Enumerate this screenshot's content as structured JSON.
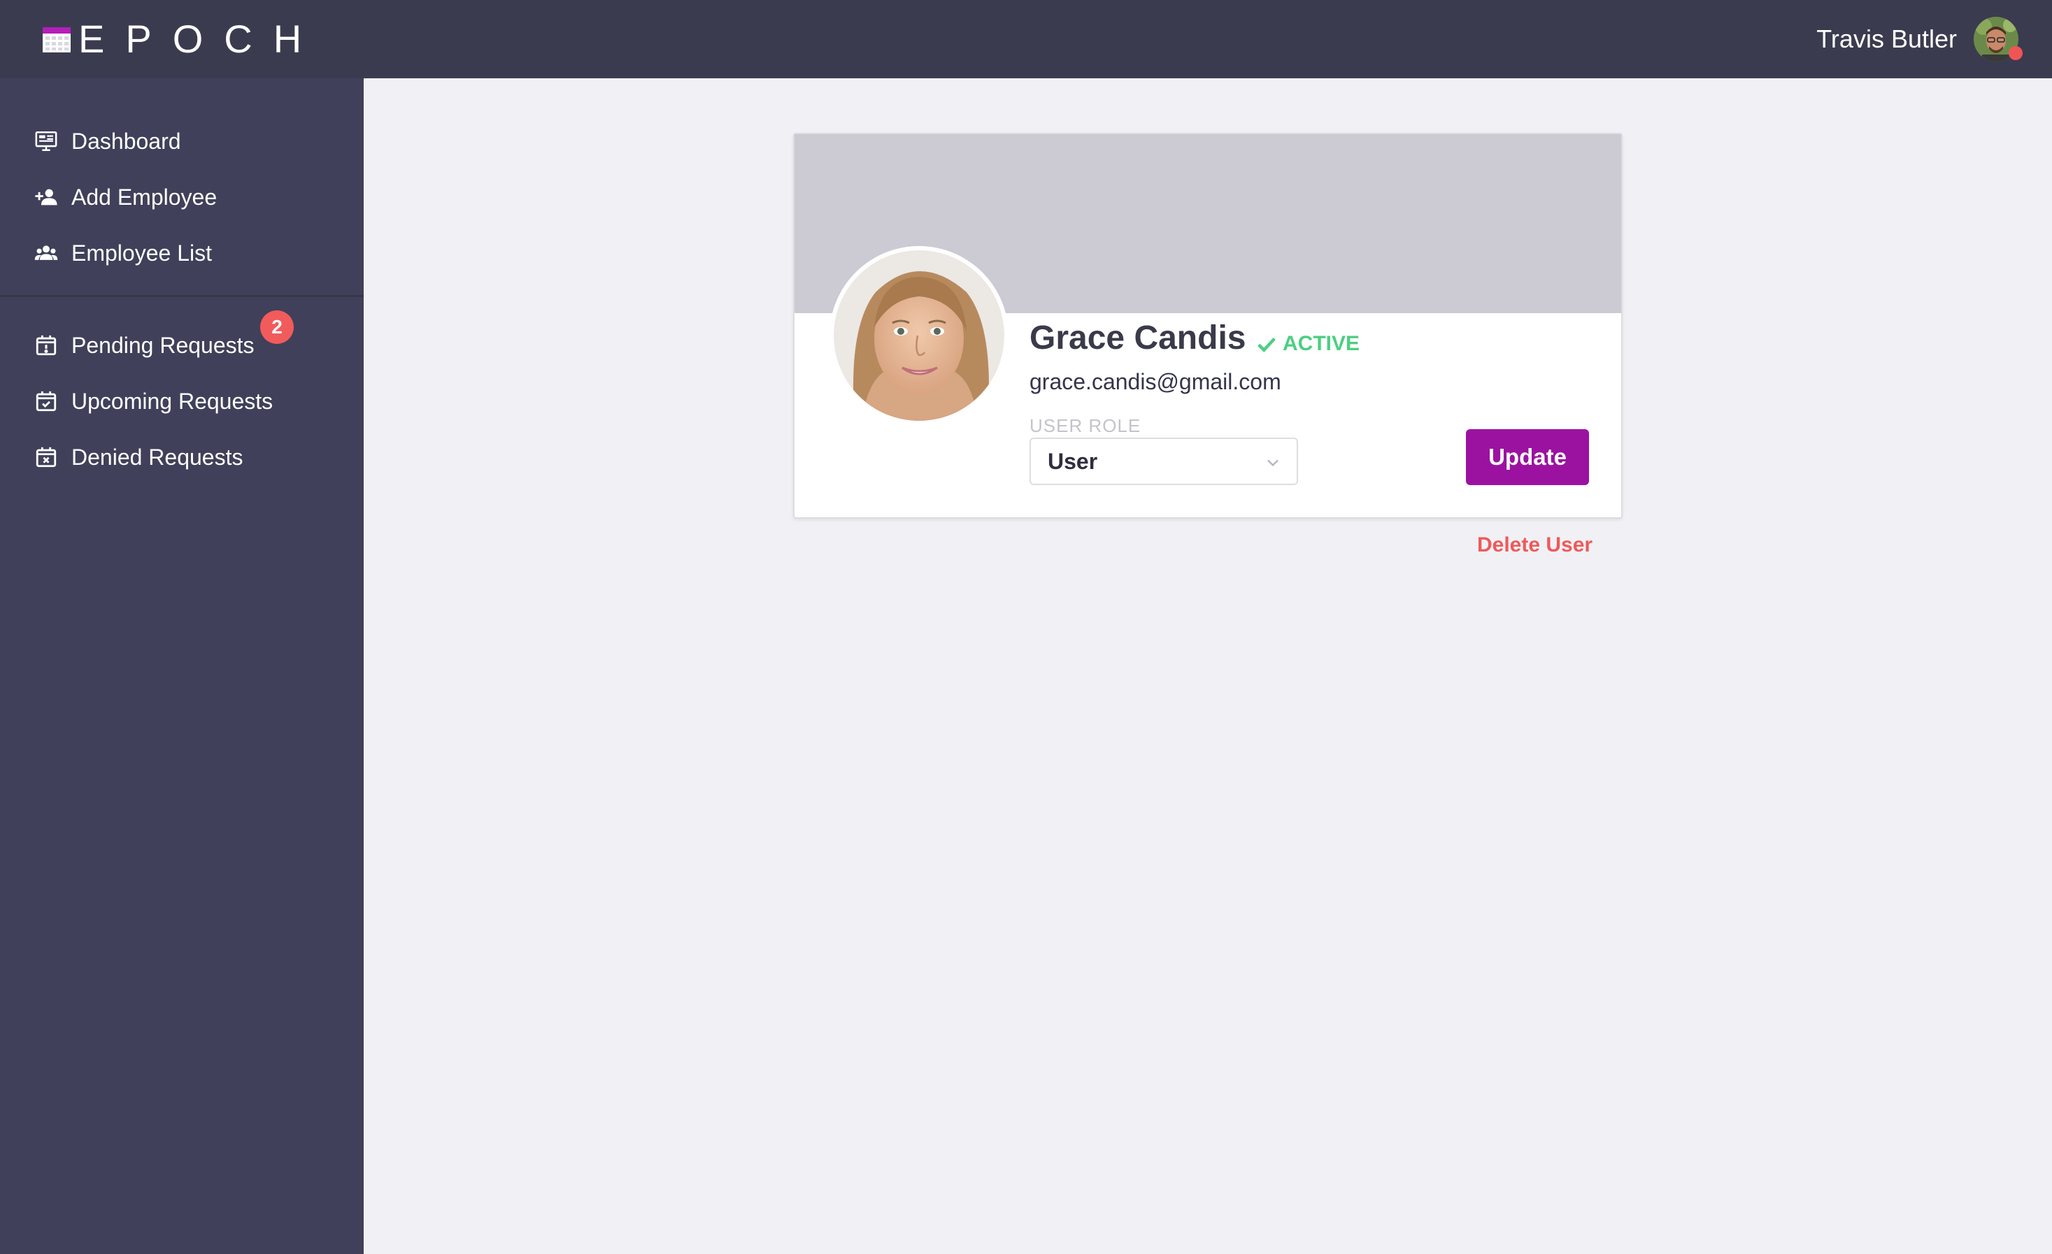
{
  "header": {
    "logo_text": "EPOCH",
    "user_name": "Travis Butler",
    "user_status_color": "#f05555"
  },
  "sidebar": {
    "primary_items": [
      {
        "label": "Dashboard",
        "icon": "dashboard-icon"
      },
      {
        "label": "Add Employee",
        "icon": "add-person-icon"
      },
      {
        "label": "Employee List",
        "icon": "people-icon"
      }
    ],
    "request_items": [
      {
        "label": "Pending Requests",
        "icon": "calendar-alert-icon",
        "badge": "2"
      },
      {
        "label": "Upcoming Requests",
        "icon": "calendar-check-icon"
      },
      {
        "label": "Denied Requests",
        "icon": "calendar-x-icon"
      }
    ]
  },
  "profile": {
    "name": "Grace Candis",
    "status": "ACTIVE",
    "email": "grace.candis@gmail.com",
    "role_label": "USER ROLE",
    "role_value": "User",
    "update_label": "Update",
    "delete_label": "Delete User"
  },
  "colors": {
    "accent": "#9b12a0",
    "status_active": "#4ccf82",
    "danger": "#ee5a5a",
    "topbar": "#3b3b50",
    "sidebar": "#40405a"
  }
}
